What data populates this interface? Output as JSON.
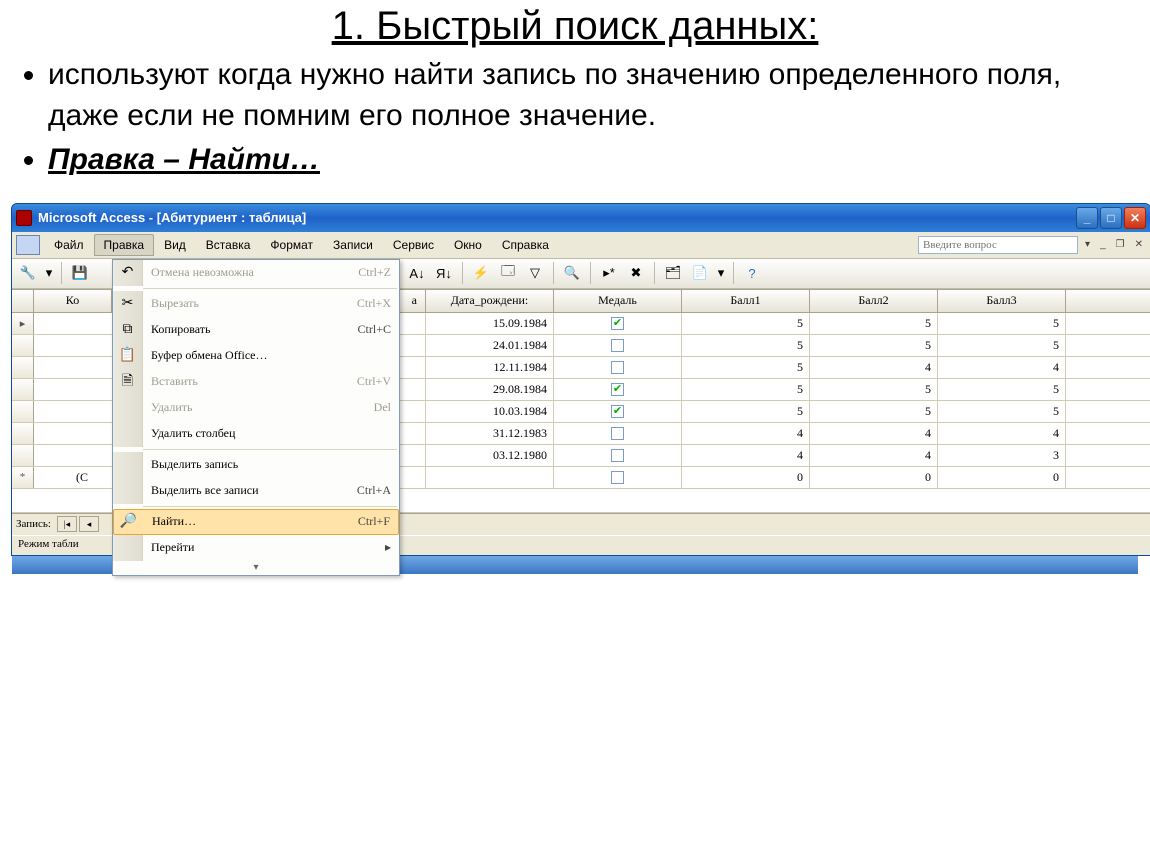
{
  "slide": {
    "title": "1. Быстрый поиск данных:",
    "bullet1": "используют когда нужно найти запись по значению определенного поля, даже если не помним его полное значение.",
    "bullet2": "Правка – Найти…"
  },
  "app": {
    "title": "Microsoft Access - [Абитуриент : таблица]",
    "help_placeholder": "Введите вопрос"
  },
  "menus": [
    "Файл",
    "Правка",
    "Вид",
    "Вставка",
    "Формат",
    "Записи",
    "Сервис",
    "Окно",
    "Справка"
  ],
  "dropdown": {
    "items": [
      {
        "icon": "↶",
        "label": "Отмена невозможна",
        "shortcut": "Ctrl+Z",
        "disabled": true
      },
      {
        "sep": true
      },
      {
        "icon": "✂",
        "label": "Вырезать",
        "shortcut": "Ctrl+X",
        "disabled": true
      },
      {
        "icon": "⧉",
        "label": "Копировать",
        "shortcut": "Ctrl+C",
        "disabled": false
      },
      {
        "icon": "📋",
        "label": "Буфер обмена Office…",
        "shortcut": "",
        "disabled": false
      },
      {
        "icon": "🗎",
        "label": "Вставить",
        "shortcut": "Ctrl+V",
        "disabled": true
      },
      {
        "icon": "",
        "label": "Удалить",
        "shortcut": "Del",
        "disabled": true
      },
      {
        "icon": "",
        "label": "Удалить столбец",
        "shortcut": "",
        "disabled": false
      },
      {
        "sep": true
      },
      {
        "icon": "",
        "label": "Выделить запись",
        "shortcut": "",
        "disabled": false
      },
      {
        "icon": "",
        "label": "Выделить все записи",
        "shortcut": "Ctrl+A",
        "disabled": false
      },
      {
        "sep": true
      },
      {
        "icon": "🔎",
        "label": "Найти…",
        "shortcut": "Ctrl+F",
        "disabled": false,
        "highlight": true
      },
      {
        "icon": "",
        "label": "Перейти",
        "shortcut": "",
        "disabled": false,
        "submenu": true
      }
    ]
  },
  "columns": [
    "Ко",
    "а",
    "Дата_рождени:",
    "Медаль",
    "Балл1",
    "Балл2",
    "Балл3"
  ],
  "rows": [
    [
      "15.09.1984",
      true,
      5,
      5,
      5
    ],
    [
      "24.01.1984",
      false,
      5,
      5,
      5
    ],
    [
      "12.11.1984",
      false,
      5,
      4,
      4
    ],
    [
      "29.08.1984",
      true,
      5,
      5,
      5
    ],
    [
      "10.03.1984",
      true,
      5,
      5,
      5
    ],
    [
      "31.12.1983",
      false,
      4,
      4,
      4
    ],
    [
      "03.12.1980",
      false,
      4,
      4,
      3
    ]
  ],
  "newrow_label": "(С",
  "newrow_zeros": [
    0,
    0,
    0
  ],
  "recnav": {
    "label": "Запись:"
  },
  "status": "Режим табли"
}
